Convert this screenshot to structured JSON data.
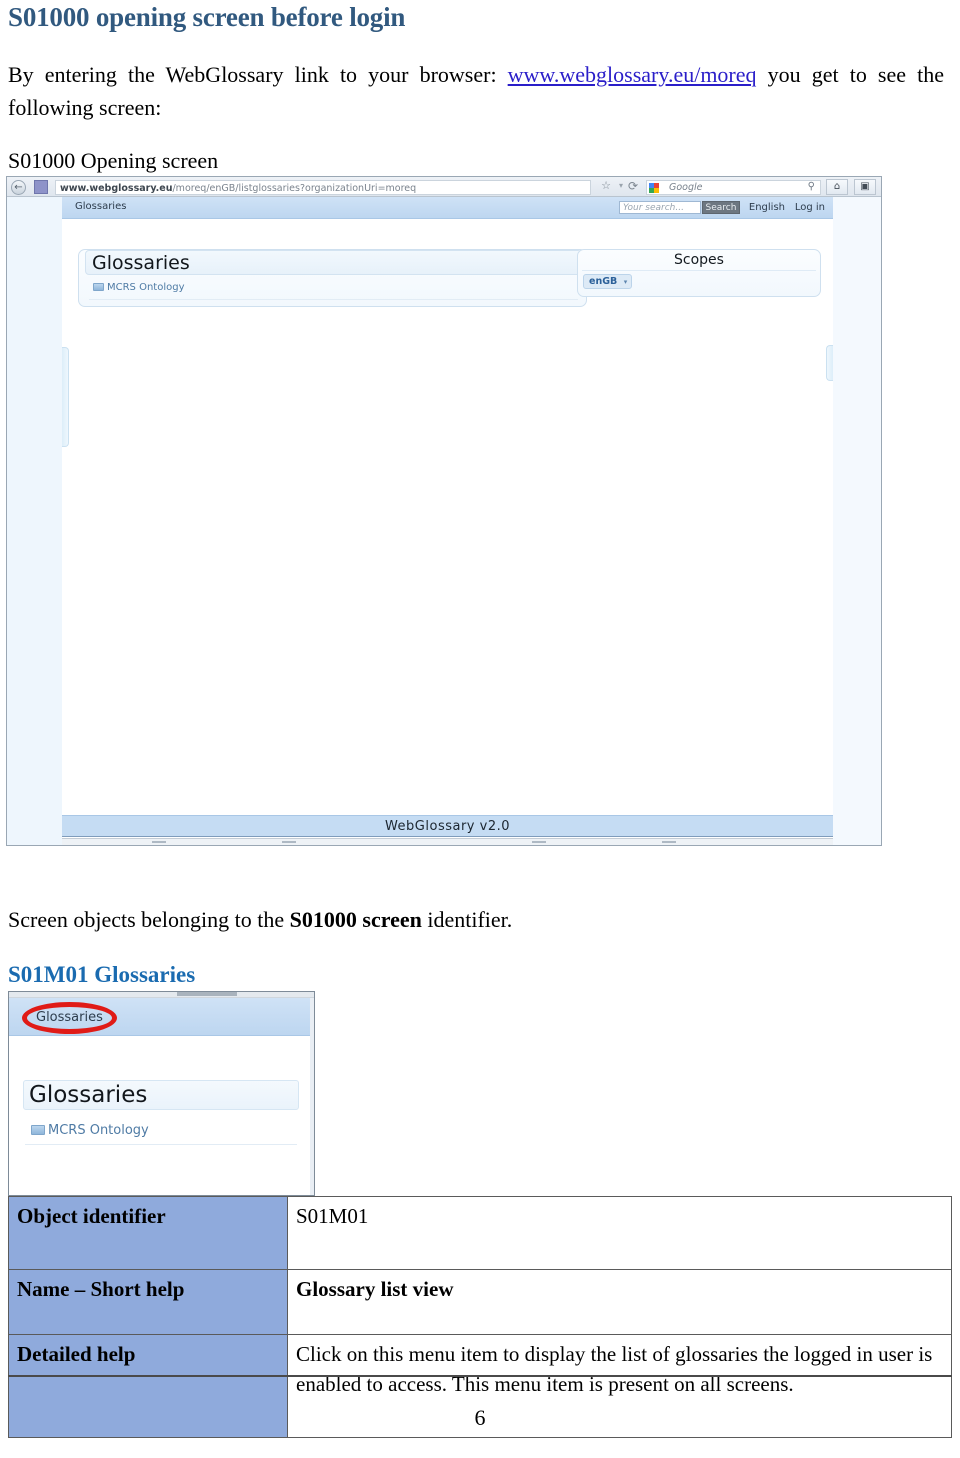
{
  "document": {
    "title": "S01000 opening screen before login",
    "intro_before_link": "By entering the WebGlossary link to your browser: ",
    "intro_link": "www.webglossary.eu/moreq",
    "intro_after_link": " you get to see the following screen:",
    "figure_caption": "S01000 Opening screen",
    "mid_text_before": "Screen objects belonging to the ",
    "mid_text_bold": "S01000 screen",
    "mid_text_after": " identifier.",
    "section_title": "S01M01 Glossaries",
    "page_number": "6"
  },
  "browser": {
    "back_arrow": "←",
    "url": "www.webglossary.eu",
    "url_path": "/moreq/enGB/listglossaries?organizationUri=moreq",
    "star_icon": "☆",
    "caret_icon": "▾",
    "reload_icon": "⟳",
    "search_placeholder": "Google",
    "magnifier_icon": "⚲",
    "home_icon": "⌂",
    "tool_icon": "▣",
    "colors": {
      "toolbar_top": "#eef2f7",
      "toolbar_bottom": "#dfe6ee"
    }
  },
  "webapp": {
    "nav_item": "Glossaries",
    "search_placeholder": "Your search...",
    "search_button": "Search",
    "language": "English",
    "login": "Log in",
    "glossaries_panel": {
      "title": "Glossaries",
      "items": [
        {
          "label": "MCRS Ontology",
          "icon": "folder-icon"
        }
      ]
    },
    "scopes_panel": {
      "title": "Scopes",
      "tag": "enGB",
      "tag_caret": "▾"
    },
    "footer": "WebGlossary v2.0",
    "accent": "#bdd6f0"
  },
  "small_screenshot": {
    "nav_item": "Glossaries",
    "heading": "Glossaries",
    "item": "MCRS Ontology",
    "highlight_color": "#e01b17"
  },
  "spec_table": {
    "rows": [
      {
        "label": "Object identifier",
        "value": "S01M01",
        "bold": false
      },
      {
        "label": "Name – Short help",
        "value": "Glossary list view",
        "bold": true
      },
      {
        "label": "Detailed help",
        "value": "Click on this menu item to display the list of glossaries the logged in user is enabled to access. This menu item is present on all screens.",
        "bold": false
      }
    ],
    "header_bg": "#8faadc"
  }
}
